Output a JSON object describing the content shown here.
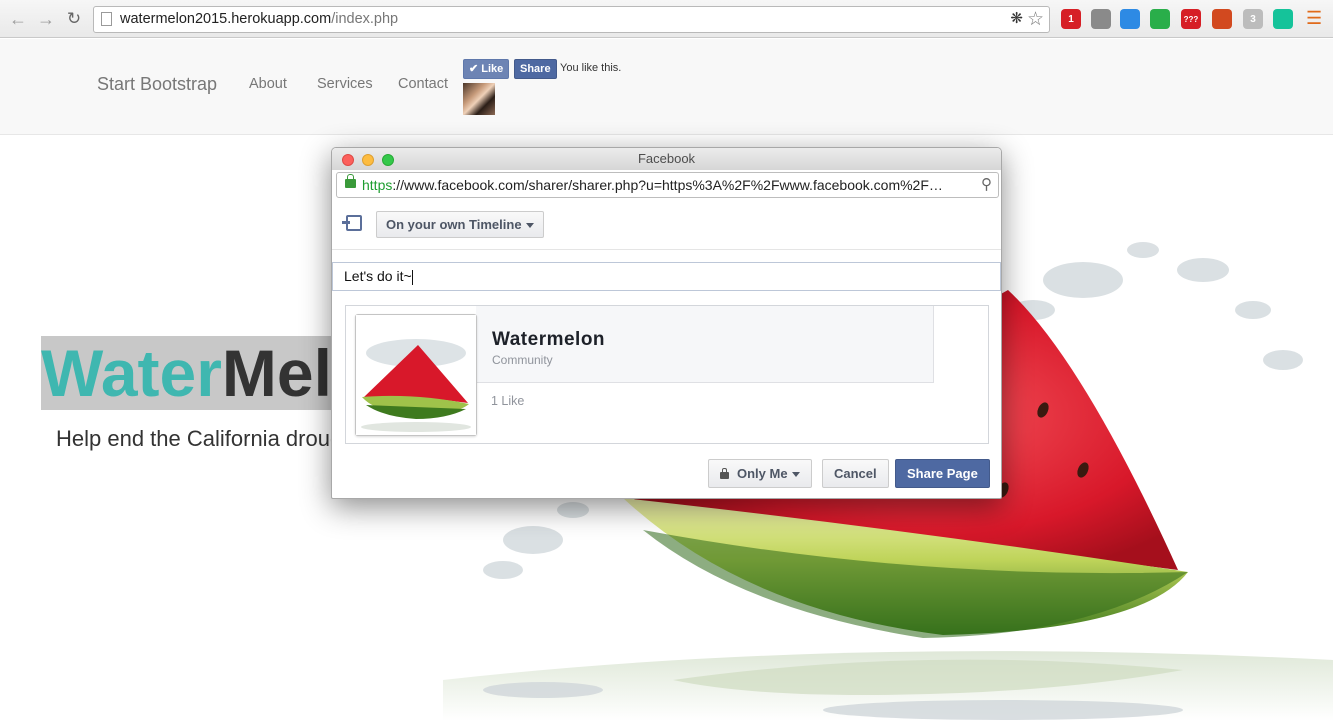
{
  "browser": {
    "url_host": "watermelon2015.herokuapp.com",
    "url_path": "/index.php",
    "extensions": [
      {
        "name": "opera-icon",
        "color": "#d61f26",
        "badge": "1"
      },
      {
        "name": "eyedropper-icon",
        "color": "#8a8a8a",
        "badge": ""
      },
      {
        "name": "chrome-ext-icon",
        "color": "#2d8ae4",
        "badge": ""
      },
      {
        "name": "quote-icon",
        "color": "#2aae4a",
        "badge": ""
      },
      {
        "name": "translate-icon",
        "color": "#d61f26",
        "badge": "???"
      },
      {
        "name": "todo-icon",
        "color": "#d2491f",
        "badge": ""
      },
      {
        "name": "grey-circle-icon",
        "color": "#bcbcbc",
        "badge": "3"
      },
      {
        "name": "grammarly-icon",
        "color": "#15c39a",
        "badge": ""
      }
    ]
  },
  "site": {
    "brand": "Start Bootstrap",
    "nav": [
      "About",
      "Services",
      "Contact"
    ],
    "fb_like_label": "Like",
    "fb_share_label": "Share",
    "fb_liked_text": "You like this.",
    "hero_title_part1": "Water",
    "hero_title_part2": "Melon",
    "hero_subtitle": "Help end the California drought"
  },
  "popup": {
    "window_title": "Facebook",
    "url_proto": "https",
    "url_rest": "://www.facebook.com/sharer/sharer.php?u=https%3A%2F%2Fwww.facebook.com%2F…",
    "timeline_select": "On your own Timeline",
    "message": "Let's do it~",
    "preview": {
      "page_name": "Watermelon",
      "category": "Community",
      "likes": "1 Like"
    },
    "privacy_label": "Only Me",
    "cancel_label": "Cancel",
    "share_label": "Share Page"
  },
  "colors": {
    "accent_teal": "#3fb7b0",
    "facebook_blue": "#4e69a2"
  }
}
